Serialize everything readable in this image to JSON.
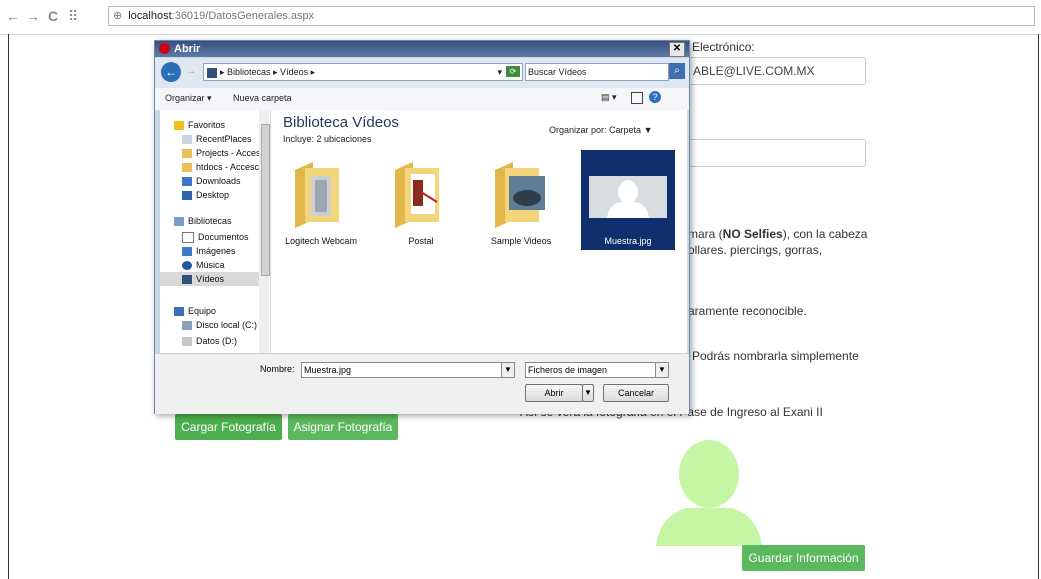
{
  "browser": {
    "url_host": "localhost",
    "url_path": ":36019/DatosGenerales.aspx"
  },
  "page": {
    "email_label": "Electrónico:",
    "email_value": "ABLE@LIVE.COM.MX",
    "instruction_1a": "mara (",
    "instruction_1b": "NO Selfies",
    "instruction_1c": "), con la cabeza",
    "instruction_2": "ollares. piercings, gorras,",
    "instruction_3": "aramente reconocible.",
    "instruction_4": "Podrás nombrarla simplemente",
    "preview_caption": "Así se verá la fotografía en el Pase de Ingreso al Exani II",
    "btn_upload": "Cargar Fotografía",
    "btn_assign": "Asignar Fotografía",
    "btn_save": "Guardar Información"
  },
  "dialog": {
    "title": "Abrir",
    "breadcrumb": "▸ Bibliotecas ▸ Vídeos ▸",
    "search_placeholder": "Buscar Vídeos",
    "toolbar": {
      "organize": "Organizar ▾",
      "new_folder": "Nueva carpeta"
    },
    "nav": {
      "favorites": "Favoritos",
      "recent": "RecentPlaces",
      "projects": "Projects - Acces",
      "htdocs": "htdocs - Accesc",
      "downloads": "Downloads",
      "desktop": "Desktop",
      "libraries": "Bibliotecas",
      "docs": "Documentos",
      "images": "Imágenes",
      "music": "Música",
      "videos": "Vídeos",
      "computer": "Equipo",
      "disk_c": "Disco local (C:)",
      "disk_d": "Datos (D:)"
    },
    "library_title": "Biblioteca Vídeos",
    "library_sub": "Incluye: 2 ubicaciones",
    "arrange_label": "Organizar por:",
    "arrange_value": "Carpeta ▼",
    "items": [
      "Logitech Webcam",
      "Postal",
      "Sample Videos",
      "Muestra.jpg"
    ],
    "filename_label": "Nombre:",
    "filename_value": "Muestra.jpg",
    "filetype_value": "Ficheros de imagen",
    "btn_open": "Abrir",
    "btn_cancel": "Cancelar"
  }
}
